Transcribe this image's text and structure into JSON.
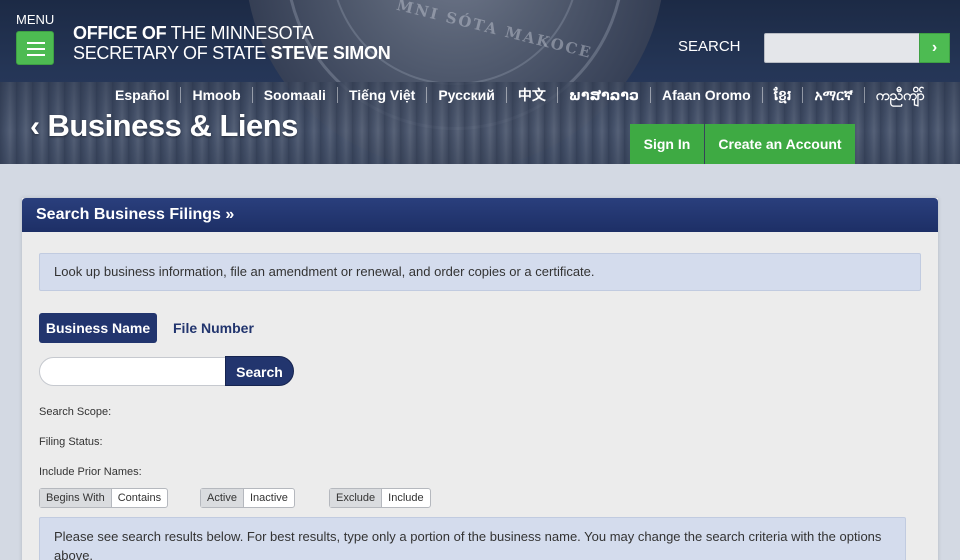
{
  "header": {
    "menu_label": "MENU",
    "logo_line1_bold": "OFFICE OF",
    "logo_line1_rest": " THE MINNESOTA",
    "logo_line2_rest": "SECRETARY OF STATE ",
    "logo_line2_bold": "STEVE SIMON",
    "seal_text": "MNI SÓTA MAKOCE",
    "search_label": "SEARCH",
    "search_placeholder": "",
    "search_go": "›",
    "languages": [
      "Español",
      "Hmoob",
      "Soomaali",
      "Tiếng Việt",
      "Русский",
      "中文",
      "ພາສາລາວ",
      "Afaan Oromo",
      "ខ្មែរ",
      "አማርኛ",
      "ကညီကျိာ်"
    ],
    "page_heading": "Business & Liens",
    "chevron": "‹",
    "sign_in": "Sign In",
    "create_account": "Create an Account"
  },
  "card": {
    "title": "Search Business Filings »",
    "info_text": "Look up business information, file an amendment or renewal, and order copies or a certificate.",
    "tabs": [
      "Business Name",
      "File Number"
    ],
    "search_input_value": "",
    "search_button": "Search",
    "labels": {
      "scope": "Search Scope:",
      "status": "Filing Status:",
      "prior": "Include Prior Names:"
    },
    "scope_options": [
      "Begins With",
      "Contains"
    ],
    "status_options": [
      "Active",
      "Inactive"
    ],
    "prior_options": [
      "Exclude",
      "Include"
    ],
    "results_text": "Please see search results below. For best results, type only a portion of the business name. You may change the search criteria with the options above."
  },
  "colors": {
    "header_navy": "#1c2a45",
    "green": "#4dbb52",
    "card_navy": "#22356e",
    "info_bg": "#d4dced"
  }
}
